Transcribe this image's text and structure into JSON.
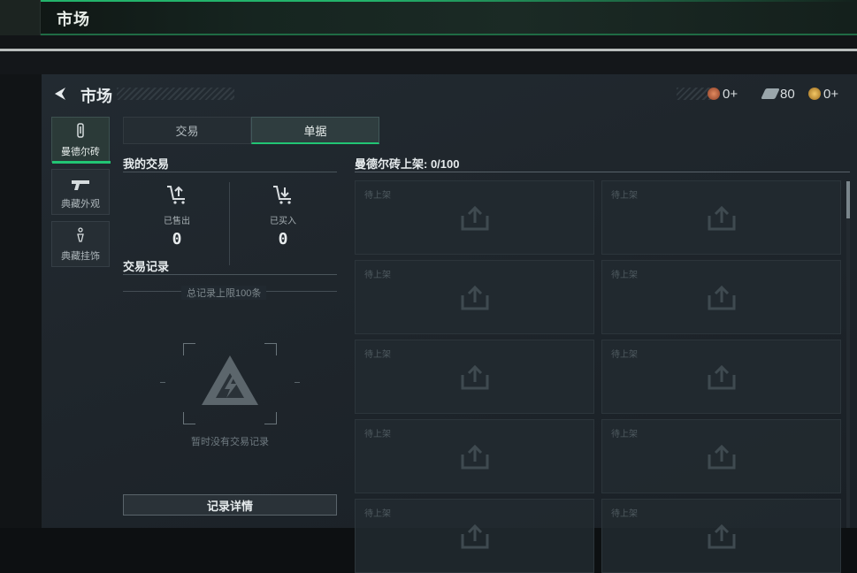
{
  "top_bar": {
    "title": "市场"
  },
  "header": {
    "title": "市场"
  },
  "currencies": [
    {
      "name": "medal-currency",
      "value": "0+",
      "color": "#c0613f"
    },
    {
      "name": "ticket-currency",
      "value": "80",
      "color": "#9aa6ab"
    },
    {
      "name": "coin-currency",
      "value": "0+",
      "color": "#d7a13a"
    }
  ],
  "side_tabs": [
    {
      "label": "曼德尔砖",
      "icon": "brick-icon"
    },
    {
      "label": "典藏外观",
      "icon": "pistol-icon"
    },
    {
      "label": "典藏挂饰",
      "icon": "charm-icon"
    }
  ],
  "tabs": {
    "trade": "交易",
    "order": "单据"
  },
  "my_trades": {
    "title": "我的交易",
    "sold_label": "已售出",
    "sold_value": "0",
    "bought_label": "已买入",
    "bought_value": "0"
  },
  "records": {
    "title": "交易记录",
    "limit_text": "总记录上限100条",
    "empty_text": "暂时没有交易记录",
    "detail_button": "记录详情"
  },
  "listing": {
    "title": "曼德尔砖上架: 0/100",
    "slot_label": "待上架",
    "slots": 10
  },
  "colors": {
    "accent": "#22c574",
    "background": "#1f262c"
  }
}
